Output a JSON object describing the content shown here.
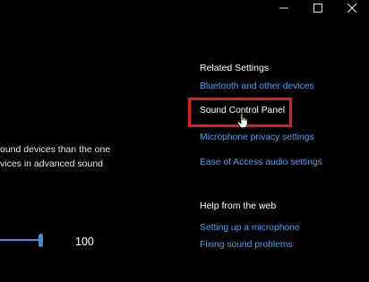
{
  "window": {
    "controls": {
      "minimize_icon": "minimize-icon",
      "maximize_icon": "maximize-icon",
      "close_icon": "close-icon"
    }
  },
  "main": {
    "description_lines": [
      "ound devices than the one",
      "vices in advanced sound"
    ],
    "volume": {
      "value_text": "100",
      "level_percent": 100
    }
  },
  "related_settings": {
    "title": "Related Settings",
    "links": [
      "Bluetooth and other devices",
      "Sound Control Panel",
      "Microphone privacy settings",
      "Ease of Access audio settings"
    ],
    "highlighted_index": 1
  },
  "help": {
    "title": "Help from the web",
    "links": [
      "Setting up a microphone",
      "Fixing sound problems"
    ]
  },
  "colors": {
    "background": "#000000",
    "link": "#4aa0ee",
    "accent": "#3a8fe0",
    "highlight_border": "#e0201e"
  }
}
